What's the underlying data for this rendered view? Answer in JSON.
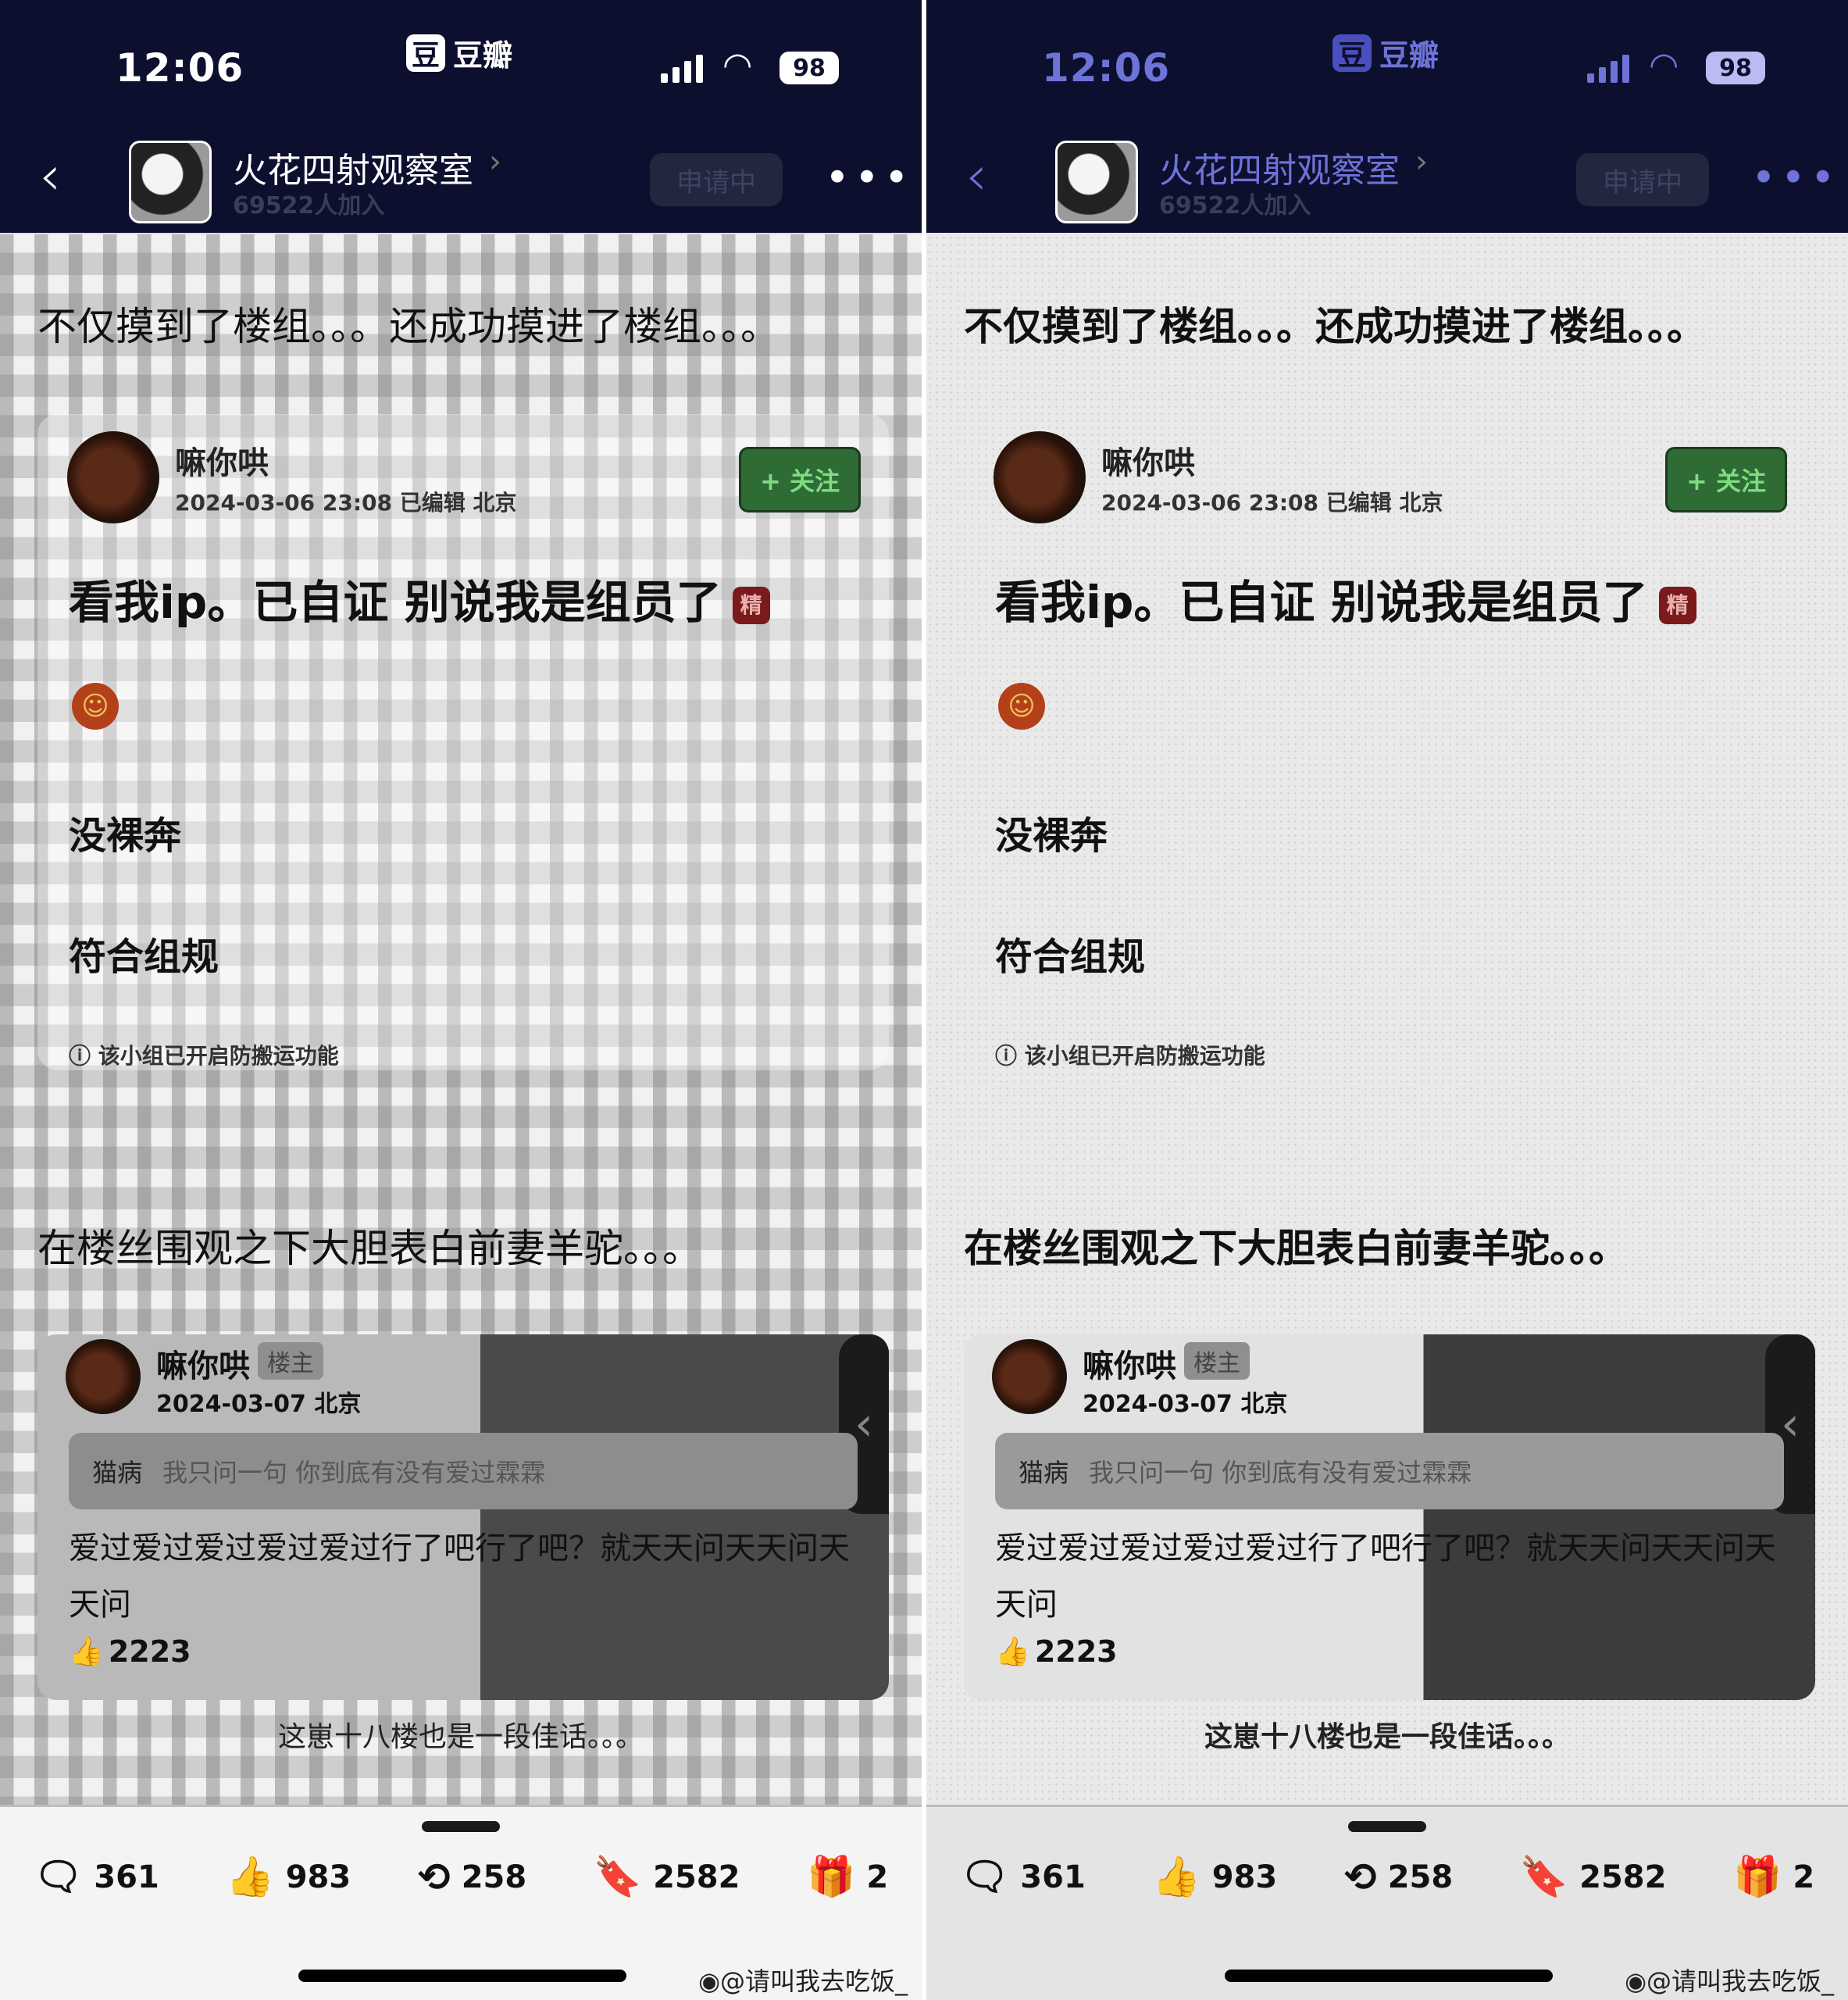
{
  "status_bar": {
    "time": "12:06",
    "app_logo": "豆",
    "app_name": "豆瓣",
    "battery": "98"
  },
  "group": {
    "name": "火花四射观察室",
    "members": "69522人加入",
    "apply_label": "申请中"
  },
  "headline_1": "不仅摸到了楼组。。。还成功摸进了楼组。。。",
  "post": {
    "username": "嘛你哄",
    "meta": "2024-03-06 23:08 已编辑 北京",
    "follow_label": "+ 关注",
    "title": "看我ip。已自证 别说我是组员了",
    "badge": "精",
    "line_1": "没裸奔",
    "line_2": "符合组规",
    "note": "ⓘ 该小组已开启防搬运功能"
  },
  "headline_2": "在楼丝围观之下大胆表白前妻羊驼。。。",
  "reply": {
    "username": "嘛你哄",
    "tag": "楼主",
    "meta": "2024-03-07 北京",
    "quote_name": "猫病",
    "quote_text": "我只问一句 你到底有没有爱过霖霖",
    "body": "爱过爱过爱过爱过爱过行了吧行了吧？就天天问天天问天天问",
    "likes": "2223"
  },
  "caption": "这崽十八楼也是一段佳话。。。",
  "action_bar": {
    "comments": "361",
    "likes": "983",
    "reshares": "258",
    "saves": "2582",
    "gifts": "2"
  },
  "watermark": "@请叫我去吃饭_",
  "icons": [
    "chevron-left-icon",
    "more-icon",
    "comment-icon",
    "thumbs-up-icon",
    "reshare-icon",
    "bookmark-icon",
    "gift-icon",
    "weibo-icon"
  ]
}
